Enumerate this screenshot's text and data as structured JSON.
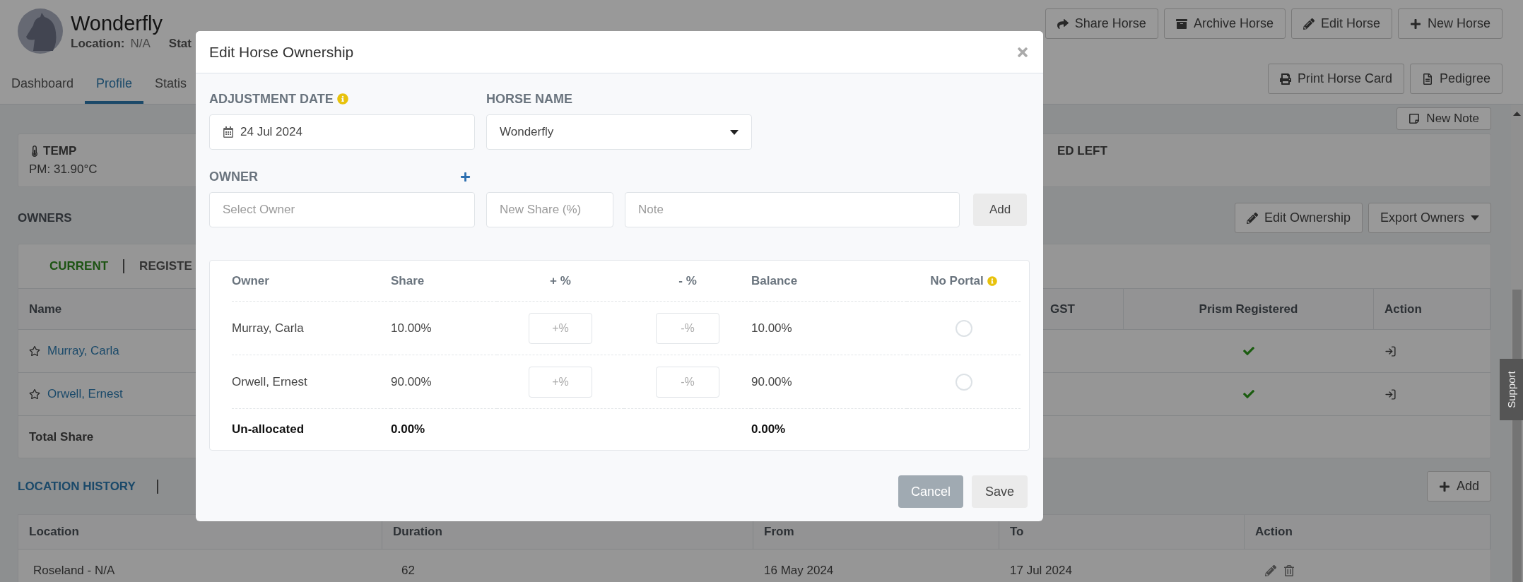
{
  "horse": {
    "name": "Wonderfly",
    "location_label": "Location:",
    "location": "N/A",
    "status_label": "Stat"
  },
  "header_buttons": [
    {
      "label": "Share Horse"
    },
    {
      "label": "Archive Horse"
    },
    {
      "label": "Edit Horse"
    },
    {
      "label": "New Horse"
    }
  ],
  "secondary_buttons": [
    {
      "label": "Print Horse Card"
    },
    {
      "label": "Pedigree"
    }
  ],
  "tabs": [
    {
      "label": "Dashboard",
      "selected": false
    },
    {
      "label": "Profile",
      "selected": true
    },
    {
      "label": "Statis",
      "selected": false
    }
  ],
  "new_note_button": {
    "label": "New Note"
  },
  "temp_card": {
    "label": "TEMP",
    "value": "PM: 31.90°C",
    "cut_label": "ED LEFT"
  },
  "owners": {
    "title": "OWNERS",
    "buttons": [
      {
        "label": "Edit Ownership"
      },
      {
        "label": "Export Owners"
      }
    ],
    "tabs": [
      {
        "label": "CURRENT",
        "selected": true
      },
      {
        "label": "REGISTE",
        "selected": false
      }
    ],
    "columns": [
      "Name",
      "GST",
      "Prism Registered",
      "Action"
    ],
    "rows": [
      {
        "name": "Murray, Carla",
        "starred": false,
        "prism_registered": true
      },
      {
        "name": "Orwell, Ernest",
        "starred": false,
        "prism_registered": true
      }
    ],
    "total_label": "Total Share"
  },
  "location_history": {
    "tab": {
      "label": "LOCATION HISTORY",
      "selected": true
    },
    "add_button": "Add",
    "columns": [
      "Location",
      "Duration",
      "From",
      "To",
      "Action"
    ],
    "rows": [
      {
        "location": "Roseland - N/A",
        "duration": "62",
        "from": "16 May 2024",
        "to": "17 Jul 2024"
      }
    ]
  },
  "support_tab": "Support",
  "modal": {
    "title": "Edit Horse Ownership",
    "date_label": "ADJUSTMENT DATE",
    "date": "24 Jul 2024",
    "horse_label": "HORSE NAME",
    "horse": "Wonderfly",
    "owner_label": "OWNER",
    "owner_placeholder": "Select Owner",
    "share_placeholder": "New Share (%)",
    "note_placeholder": "Note",
    "add_button": "Add",
    "columns": [
      "Owner",
      "Share",
      "+ %",
      "- %",
      "Balance",
      "No Portal"
    ],
    "rows": [
      {
        "owner": "Murray, Carla",
        "share": "10.00%",
        "plus_placeholder": "+%",
        "minus_placeholder": "-%",
        "balance": "10.00%",
        "no_portal": false
      },
      {
        "owner": "Orwell, Ernest",
        "share": "90.00%",
        "plus_placeholder": "+%",
        "minus_placeholder": "-%",
        "balance": "90.00%",
        "no_portal": false
      }
    ],
    "total": {
      "label": "Un-allocated",
      "share": "0.00%",
      "balance": "0.00%"
    },
    "cancel_button": "Cancel",
    "save_button": "Save"
  }
}
